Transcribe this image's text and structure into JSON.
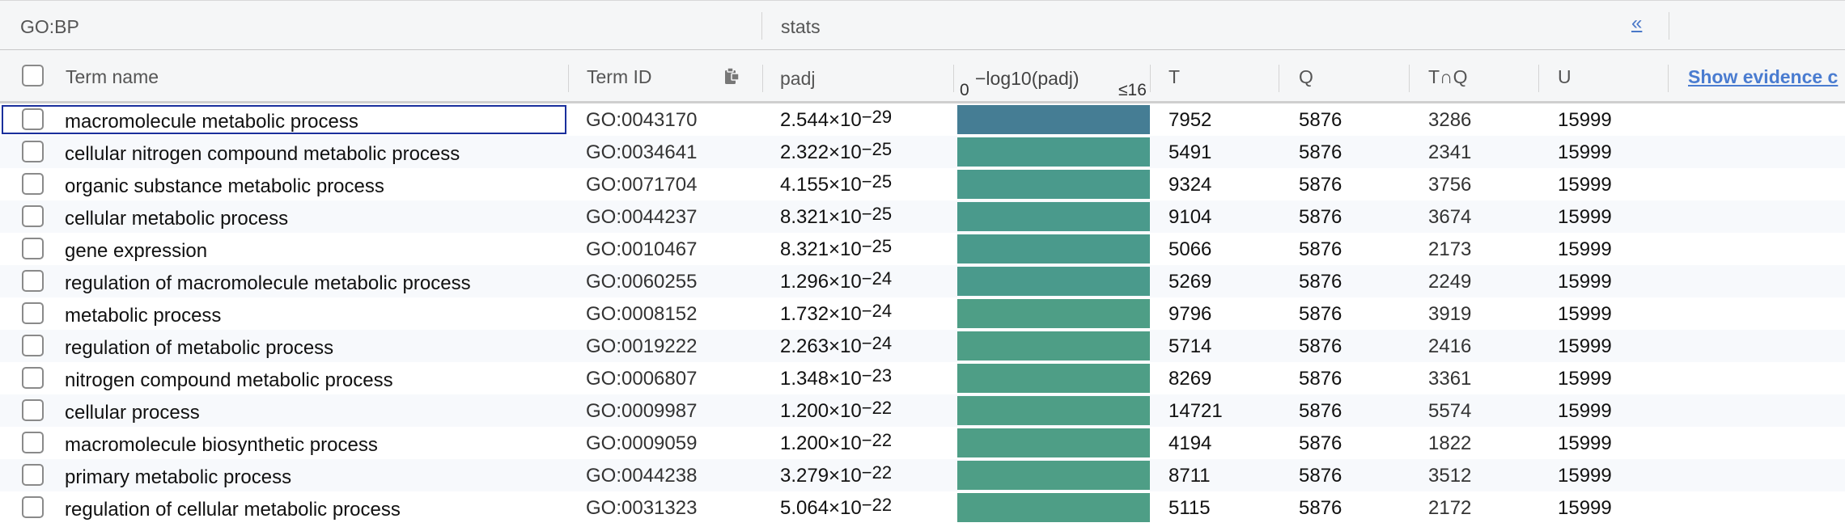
{
  "group_header": {
    "source": "GO:BP",
    "stats": "stats",
    "collapse_icon": "«"
  },
  "columns": {
    "term_name": "Term name",
    "term_id": "Term ID",
    "padj": "padj",
    "neglog_zero": "0",
    "neglog_title": "−log10(padj)",
    "neglog_max": "≤16",
    "t": "T",
    "q": "Q",
    "tq": "T∩Q",
    "u": "U",
    "show_evidence": "Show evidence c"
  },
  "colors": {
    "bar_top": "#457d94",
    "bar_default": "#4a9a8c",
    "bar_light": "#4e9e86",
    "link": "#4a7cd0",
    "selection_outline": "#1a2f9c"
  },
  "rows": [
    {
      "name": "macromolecule metabolic process",
      "id": "GO:0043170",
      "padj_mant": "2.544×10",
      "padj_exp": "−29",
      "bar_fraction": 1.0,
      "t": "7952",
      "q": "5876",
      "tq": "3286",
      "u": "15999"
    },
    {
      "name": "cellular nitrogen compound metabolic process",
      "id": "GO:0034641",
      "padj_mant": "2.322×10",
      "padj_exp": "−25",
      "bar_fraction": 1.0,
      "t": "5491",
      "q": "5876",
      "tq": "2341",
      "u": "15999"
    },
    {
      "name": "organic substance metabolic process",
      "id": "GO:0071704",
      "padj_mant": "4.155×10",
      "padj_exp": "−25",
      "bar_fraction": 1.0,
      "t": "9324",
      "q": "5876",
      "tq": "3756",
      "u": "15999"
    },
    {
      "name": "cellular metabolic process",
      "id": "GO:0044237",
      "padj_mant": "8.321×10",
      "padj_exp": "−25",
      "bar_fraction": 1.0,
      "t": "9104",
      "q": "5876",
      "tq": "3674",
      "u": "15999"
    },
    {
      "name": "gene expression",
      "id": "GO:0010467",
      "padj_mant": "8.321×10",
      "padj_exp": "−25",
      "bar_fraction": 1.0,
      "t": "5066",
      "q": "5876",
      "tq": "2173",
      "u": "15999"
    },
    {
      "name": "regulation of macromolecule metabolic process",
      "id": "GO:0060255",
      "padj_mant": "1.296×10",
      "padj_exp": "−24",
      "bar_fraction": 1.0,
      "t": "5269",
      "q": "5876",
      "tq": "2249",
      "u": "15999"
    },
    {
      "name": "metabolic process",
      "id": "GO:0008152",
      "padj_mant": "1.732×10",
      "padj_exp": "−24",
      "bar_fraction": 1.0,
      "t": "9796",
      "q": "5876",
      "tq": "3919",
      "u": "15999"
    },
    {
      "name": "regulation of metabolic process",
      "id": "GO:0019222",
      "padj_mant": "2.263×10",
      "padj_exp": "−24",
      "bar_fraction": 1.0,
      "t": "5714",
      "q": "5876",
      "tq": "2416",
      "u": "15999"
    },
    {
      "name": "nitrogen compound metabolic process",
      "id": "GO:0006807",
      "padj_mant": "1.348×10",
      "padj_exp": "−23",
      "bar_fraction": 1.0,
      "t": "8269",
      "q": "5876",
      "tq": "3361",
      "u": "15999"
    },
    {
      "name": "cellular process",
      "id": "GO:0009987",
      "padj_mant": "1.200×10",
      "padj_exp": "−22",
      "bar_fraction": 1.0,
      "t": "14721",
      "q": "5876",
      "tq": "5574",
      "u": "15999"
    },
    {
      "name": "macromolecule biosynthetic process",
      "id": "GO:0009059",
      "padj_mant": "1.200×10",
      "padj_exp": "−22",
      "bar_fraction": 1.0,
      "t": "4194",
      "q": "5876",
      "tq": "1822",
      "u": "15999"
    },
    {
      "name": "primary metabolic process",
      "id": "GO:0044238",
      "padj_mant": "3.279×10",
      "padj_exp": "−22",
      "bar_fraction": 1.0,
      "t": "8711",
      "q": "5876",
      "tq": "3512",
      "u": "15999"
    },
    {
      "name": "regulation of cellular metabolic process",
      "id": "GO:0031323",
      "padj_mant": "5.064×10",
      "padj_exp": "−22",
      "bar_fraction": 1.0,
      "t": "5115",
      "q": "5876",
      "tq": "2172",
      "u": "15999"
    }
  ]
}
